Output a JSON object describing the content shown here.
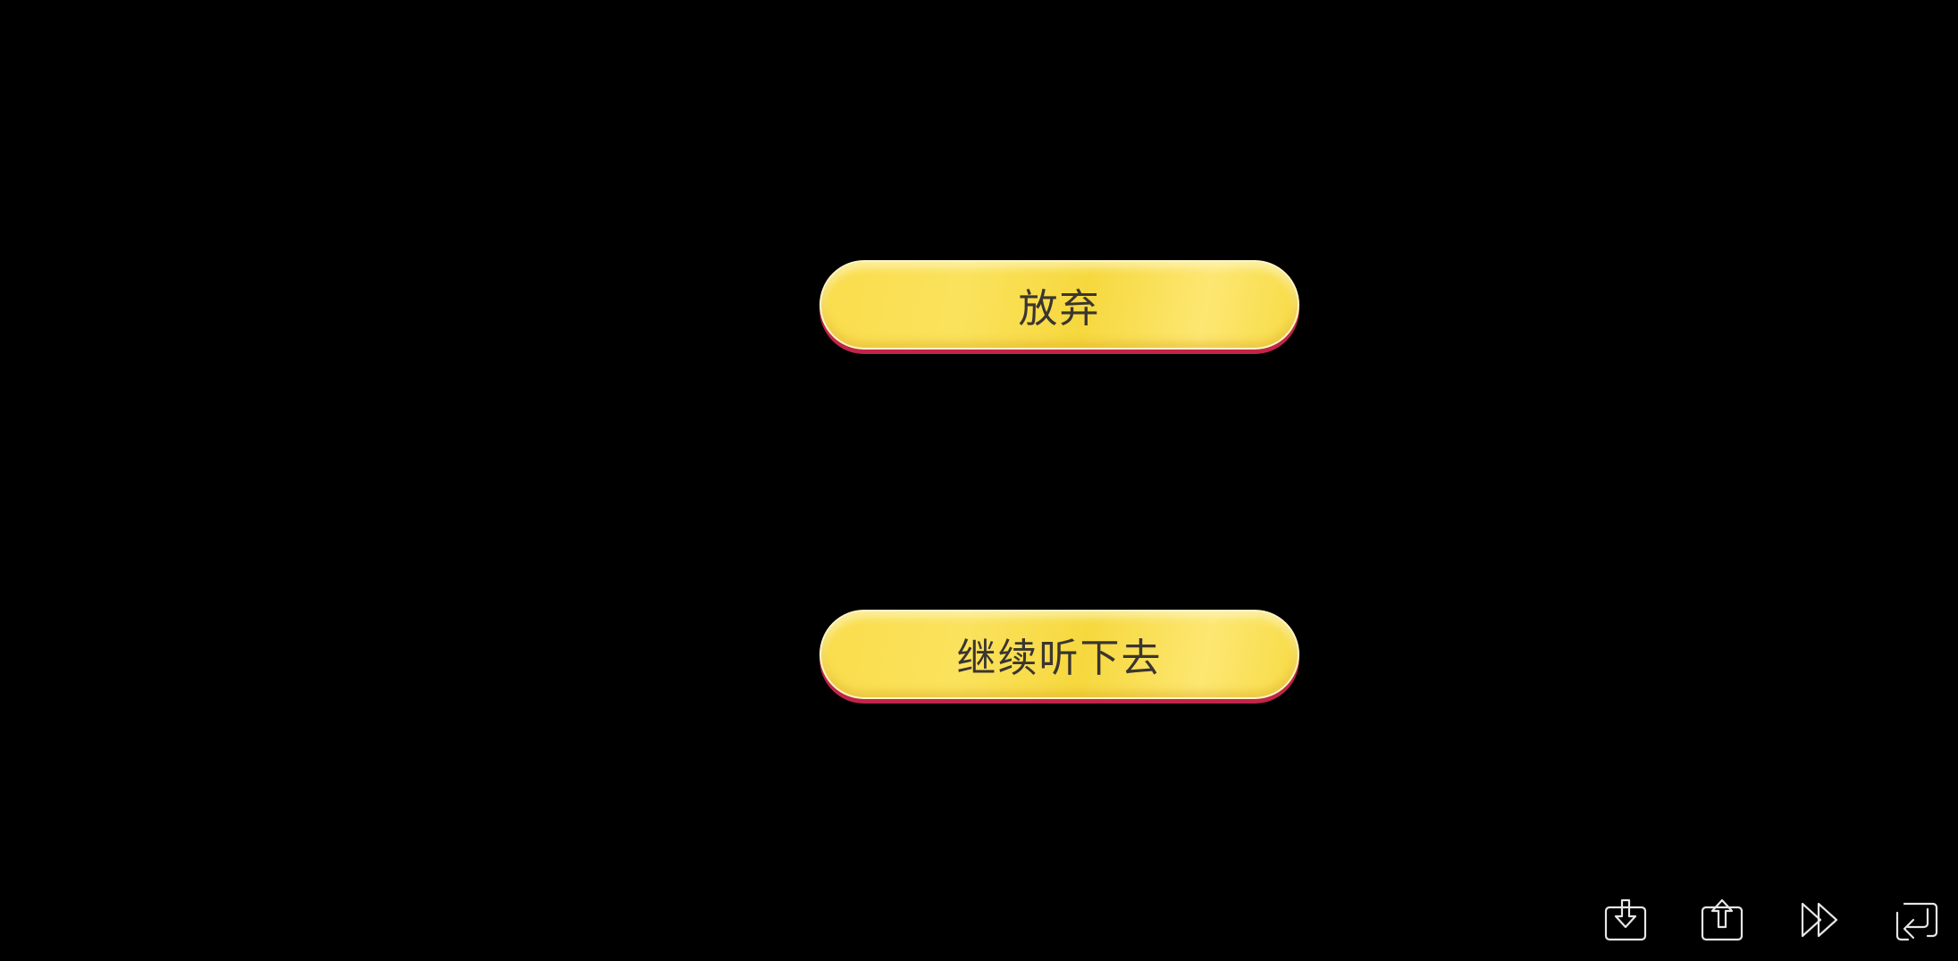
{
  "choices": [
    {
      "label": "放弃"
    },
    {
      "label": "继续听下去"
    }
  ],
  "toolbar": {
    "icons": [
      "save-icon",
      "load-icon",
      "skip-icon",
      "auto-icon"
    ]
  },
  "colors": {
    "background": "#000000",
    "button_yellow": "#f9dd4c",
    "button_shadow": "#c2244a",
    "label_text": "#3b3530",
    "icon_stroke": "#e6e6e6"
  }
}
